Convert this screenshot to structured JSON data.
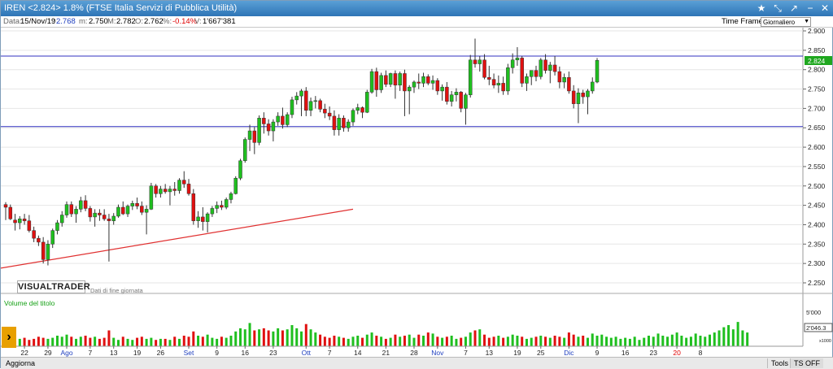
{
  "window": {
    "title": "IREN <2.824> 1.8%  (FTSE Italia Servizi di Pubblica Utilità)",
    "controls": [
      "★",
      "⤡",
      "↗",
      "−",
      "✕"
    ]
  },
  "info": {
    "data_label": "Data:",
    "data_value": "15/Nov/19",
    "colon": ":",
    "close_value": "2.768",
    "min_label": "m:",
    "min_value": "2.750",
    "max_label": "M:",
    "max_value": "2.782",
    "open_label": "O:",
    "open_value": "2.762",
    "pct_label": "%:",
    "pct_value": "-0.14%",
    "vol_label": "V:",
    "vol_value": "1'667'381",
    "timeframe_label": "Time Frame",
    "timeframe_value": "Giornaliero"
  },
  "brand": {
    "logo": "VISUALTRADER",
    "eod_note": "Dati di fine giornata"
  },
  "volume_panel": {
    "label": "Volume del titolo",
    "tick_5000": "5'000",
    "current": "2'046.3",
    "scale": "x1000"
  },
  "bottom": {
    "aggiorna": "Aggiorna",
    "tools": "Tools",
    "ts_off": "TS OFF"
  },
  "colors": {
    "up": "#1fbf1f",
    "down": "#e01010",
    "hline": "#3030c0",
    "trend": "#e03030"
  },
  "chart_data": {
    "type": "candlestick",
    "ylim": [
      2.22,
      2.91
    ],
    "y_ticks": [
      "2.900",
      "2.850",
      "2.800",
      "2.750",
      "2.700",
      "2.650",
      "2.600",
      "2.550",
      "2.500",
      "2.450",
      "2.400",
      "2.350",
      "2.300",
      "2.250"
    ],
    "last_price_label": "2.824",
    "hlines": [
      2.835,
      2.653
    ],
    "trendline": {
      "from": [
        0,
        2.288
      ],
      "to": [
        74,
        2.44
      ]
    },
    "x_labels": [
      {
        "i": 4,
        "t": "22"
      },
      {
        "i": 9,
        "t": "29"
      },
      {
        "i": 13,
        "t": "Ago",
        "month": true
      },
      {
        "i": 18,
        "t": "7"
      },
      {
        "i": 23,
        "t": "13"
      },
      {
        "i": 28,
        "t": "19"
      },
      {
        "i": 33,
        "t": "26"
      },
      {
        "i": 39,
        "t": "Set",
        "month": true
      },
      {
        "i": 45,
        "t": "9"
      },
      {
        "i": 51,
        "t": "16"
      },
      {
        "i": 57,
        "t": "23"
      },
      {
        "i": 64,
        "t": "Ott",
        "month": true
      },
      {
        "i": 69,
        "t": "7"
      },
      {
        "i": 75,
        "t": "14"
      },
      {
        "i": 81,
        "t": "21"
      },
      {
        "i": 87,
        "t": "28"
      },
      {
        "i": 92,
        "t": "Nov",
        "month": true
      },
      {
        "i": 98,
        "t": "7"
      },
      {
        "i": 103,
        "t": "13"
      },
      {
        "i": 109,
        "t": "19"
      },
      {
        "i": 114,
        "t": "25"
      },
      {
        "i": 120,
        "t": "Dic",
        "month": true
      },
      {
        "i": 126,
        "t": "9"
      },
      {
        "i": 132,
        "t": "16"
      },
      {
        "i": 138,
        "t": "23"
      },
      {
        "i": 143,
        "t": "20",
        "red": true
      },
      {
        "i": 148,
        "t": "8"
      }
    ],
    "candles": [
      [
        2.452,
        2.458,
        2.412,
        2.445
      ],
      [
        2.445,
        2.452,
        2.412,
        2.415
      ],
      [
        2.412,
        2.428,
        2.385,
        2.405
      ],
      [
        2.405,
        2.422,
        2.388,
        2.415
      ],
      [
        2.415,
        2.428,
        2.4,
        2.41
      ],
      [
        2.41,
        2.425,
        2.38,
        2.385
      ],
      [
        2.385,
        2.395,
        2.355,
        2.365
      ],
      [
        2.365,
        2.372,
        2.345,
        2.355
      ],
      [
        2.355,
        2.368,
        2.3,
        2.31
      ],
      [
        2.31,
        2.36,
        2.295,
        2.35
      ],
      [
        2.35,
        2.39,
        2.34,
        2.385
      ],
      [
        2.385,
        2.412,
        2.375,
        2.405
      ],
      [
        2.405,
        2.435,
        2.395,
        2.425
      ],
      [
        2.425,
        2.46,
        2.418,
        2.452
      ],
      [
        2.452,
        2.46,
        2.42,
        2.428
      ],
      [
        2.428,
        2.448,
        2.405,
        2.44
      ],
      [
        2.44,
        2.472,
        2.432,
        2.462
      ],
      [
        2.462,
        2.476,
        2.435,
        2.442
      ],
      [
        2.442,
        2.448,
        2.408,
        2.42
      ],
      [
        2.42,
        2.44,
        2.395,
        2.43
      ],
      [
        2.43,
        2.44,
        2.41,
        2.425
      ],
      [
        2.425,
        2.44,
        2.41,
        2.415
      ],
      [
        2.415,
        2.428,
        2.305,
        2.41
      ],
      [
        2.41,
        2.43,
        2.4,
        2.422
      ],
      [
        2.422,
        2.452,
        2.418,
        2.445
      ],
      [
        2.445,
        2.46,
        2.425,
        2.428
      ],
      [
        2.428,
        2.452,
        2.42,
        2.448
      ],
      [
        2.448,
        2.462,
        2.438,
        2.455
      ],
      [
        2.455,
        2.47,
        2.44,
        2.448
      ],
      [
        2.448,
        2.46,
        2.425,
        2.432
      ],
      [
        2.432,
        2.45,
        2.375,
        2.44
      ],
      [
        2.44,
        2.508,
        2.438,
        2.5
      ],
      [
        2.5,
        2.505,
        2.47,
        2.48
      ],
      [
        2.48,
        2.5,
        2.47,
        2.492
      ],
      [
        2.492,
        2.505,
        2.48,
        2.485
      ],
      [
        2.485,
        2.5,
        2.45,
        2.492
      ],
      [
        2.492,
        2.51,
        2.475,
        2.488
      ],
      [
        2.488,
        2.52,
        2.48,
        2.515
      ],
      [
        2.515,
        2.538,
        2.495,
        2.505
      ],
      [
        2.505,
        2.518,
        2.475,
        2.48
      ],
      [
        2.48,
        2.492,
        2.4,
        2.41
      ],
      [
        2.41,
        2.435,
        2.392,
        2.42
      ],
      [
        2.42,
        2.445,
        2.385,
        2.408
      ],
      [
        2.408,
        2.432,
        2.38,
        2.428
      ],
      [
        2.428,
        2.448,
        2.42,
        2.442
      ],
      [
        2.442,
        2.46,
        2.43,
        2.45
      ],
      [
        2.45,
        2.462,
        2.438,
        2.445
      ],
      [
        2.445,
        2.47,
        2.44,
        2.465
      ],
      [
        2.465,
        2.485,
        2.455,
        2.48
      ],
      [
        2.48,
        2.525,
        2.478,
        2.52
      ],
      [
        2.52,
        2.57,
        2.515,
        2.565
      ],
      [
        2.565,
        2.625,
        2.56,
        2.62
      ],
      [
        2.62,
        2.658,
        2.59,
        2.642
      ],
      [
        2.642,
        2.652,
        2.582,
        2.612
      ],
      [
        2.612,
        2.682,
        2.605,
        2.675
      ],
      [
        2.675,
        2.69,
        2.635,
        2.66
      ],
      [
        2.66,
        2.672,
        2.63,
        2.642
      ],
      [
        2.642,
        2.672,
        2.615,
        2.665
      ],
      [
        2.665,
        2.69,
        2.655,
        2.68
      ],
      [
        2.68,
        2.702,
        2.648,
        2.658
      ],
      [
        2.658,
        2.69,
        2.652,
        2.684
      ],
      [
        2.684,
        2.73,
        2.675,
        2.722
      ],
      [
        2.722,
        2.742,
        2.71,
        2.732
      ],
      [
        2.732,
        2.75,
        2.68,
        2.745
      ],
      [
        2.745,
        2.755,
        2.68,
        2.695
      ],
      [
        2.695,
        2.728,
        2.68,
        2.718
      ],
      [
        2.718,
        2.732,
        2.7,
        2.72
      ],
      [
        2.72,
        2.725,
        2.69,
        2.698
      ],
      [
        2.698,
        2.712,
        2.675,
        2.688
      ],
      [
        2.688,
        2.705,
        2.67,
        2.68
      ],
      [
        2.68,
        2.695,
        2.63,
        2.645
      ],
      [
        2.645,
        2.685,
        2.63,
        2.675
      ],
      [
        2.675,
        2.682,
        2.64,
        2.65
      ],
      [
        2.65,
        2.672,
        2.64,
        2.665
      ],
      [
        2.665,
        2.7,
        2.655,
        2.695
      ],
      [
        2.695,
        2.712,
        2.685,
        2.702
      ],
      [
        2.702,
        2.705,
        2.675,
        2.69
      ],
      [
        2.69,
        2.748,
        2.688,
        2.742
      ],
      [
        2.742,
        2.802,
        2.738,
        2.795
      ],
      [
        2.795,
        2.805,
        2.73,
        2.748
      ],
      [
        2.748,
        2.792,
        2.74,
        2.785
      ],
      [
        2.785,
        2.798,
        2.755,
        2.762
      ],
      [
        2.762,
        2.792,
        2.755,
        2.79
      ],
      [
        2.79,
        2.798,
        2.725,
        2.76
      ],
      [
        2.76,
        2.795,
        2.745,
        2.79
      ],
      [
        2.79,
        2.8,
        2.68,
        2.745
      ],
      [
        2.745,
        2.76,
        2.685,
        2.755
      ],
      [
        2.755,
        2.772,
        2.74,
        2.768
      ],
      [
        2.768,
        2.79,
        2.75,
        2.765
      ],
      [
        2.765,
        2.792,
        2.755,
        2.782
      ],
      [
        2.782,
        2.788,
        2.76,
        2.765
      ],
      [
        2.765,
        2.785,
        2.748,
        2.772
      ],
      [
        2.772,
        2.778,
        2.735,
        2.745
      ],
      [
        2.745,
        2.762,
        2.72,
        2.755
      ],
      [
        2.755,
        2.768,
        2.71,
        2.718
      ],
      [
        2.718,
        2.745,
        2.705,
        2.735
      ],
      [
        2.735,
        2.752,
        2.718,
        2.742
      ],
      [
        2.742,
        2.745,
        2.69,
        2.7
      ],
      [
        2.7,
        2.74,
        2.658,
        2.735
      ],
      [
        2.735,
        2.838,
        2.728,
        2.825
      ],
      [
        2.825,
        2.88,
        2.805,
        2.815
      ],
      [
        2.815,
        2.835,
        2.795,
        2.825
      ],
      [
        2.825,
        2.84,
        2.775,
        2.78
      ],
      [
        2.78,
        2.81,
        2.76,
        2.775
      ],
      [
        2.775,
        2.79,
        2.752,
        2.76
      ],
      [
        2.76,
        2.785,
        2.74,
        2.765
      ],
      [
        2.765,
        2.782,
        2.735,
        2.745
      ],
      [
        2.745,
        2.815,
        2.735,
        2.805
      ],
      [
        2.805,
        2.842,
        2.79,
        2.825
      ],
      [
        2.825,
        2.858,
        2.81,
        2.83
      ],
      [
        2.83,
        2.835,
        2.755,
        2.765
      ],
      [
        2.765,
        2.79,
        2.745,
        2.782
      ],
      [
        2.782,
        2.795,
        2.76,
        2.798
      ],
      [
        2.798,
        2.81,
        2.77,
        2.782
      ],
      [
        2.782,
        2.83,
        2.775,
        2.825
      ],
      [
        2.825,
        2.84,
        2.79,
        2.798
      ],
      [
        2.798,
        2.82,
        2.765,
        2.812
      ],
      [
        2.812,
        2.835,
        2.785,
        2.795
      ],
      [
        2.795,
        2.808,
        2.752,
        2.768
      ],
      [
        2.768,
        2.79,
        2.752,
        2.78
      ],
      [
        2.78,
        2.795,
        2.738,
        2.745
      ],
      [
        2.745,
        2.76,
        2.7,
        2.712
      ],
      [
        2.712,
        2.752,
        2.662,
        2.74
      ],
      [
        2.74,
        2.748,
        2.712,
        2.73
      ],
      [
        2.73,
        2.75,
        2.685,
        2.745
      ],
      [
        2.745,
        2.78,
        2.738,
        2.768
      ],
      [
        2.768,
        2.83,
        2.765,
        2.824
      ]
    ],
    "volumes": [
      0.9,
      0.6,
      0.5,
      0.7,
      0.8,
      0.6,
      0.7,
      0.9,
      0.8,
      0.7,
      0.8,
      1.0,
      0.9,
      1.1,
      0.9,
      0.7,
      0.9,
      1.0,
      0.8,
      0.9,
      0.7,
      0.8,
      1.5,
      0.8,
      0.6,
      0.9,
      0.7,
      0.6,
      0.8,
      0.9,
      0.7,
      0.8,
      0.6,
      0.7,
      0.7,
      0.6,
      0.9,
      0.7,
      1.0,
      0.9,
      1.4,
      1.0,
      0.9,
      1.1,
      0.8,
      0.7,
      0.9,
      0.8,
      1.0,
      1.4,
      1.7,
      1.6,
      2.2,
      1.5,
      1.6,
      1.7,
      1.5,
      1.4,
      1.7,
      1.5,
      1.6,
      2.0,
      1.7,
      1.4,
      2.1,
      1.6,
      1.3,
      1.1,
      0.9,
      0.8,
      1.0,
      0.9,
      0.8,
      0.7,
      0.9,
      1.0,
      0.8,
      1.1,
      1.3,
      1.0,
      0.9,
      0.7,
      0.8,
      1.1,
      0.9,
      1.0,
      1.1,
      0.8,
      1.1,
      1.0,
      1.3,
      1.2,
      0.9,
      0.8,
      0.9,
      1.0,
      0.7,
      0.8,
      0.9,
      1.3,
      1.5,
      1.6,
      1.1,
      0.8,
      0.9,
      1.0,
      0.8,
      0.9,
      1.1,
      1.0,
      0.9,
      0.7,
      0.8,
      0.9,
      1.0,
      0.9,
      0.8,
      1.0,
      0.9,
      0.8,
      1.3,
      1.1,
      0.9,
      1.0,
      0.8,
      1.2,
      1.0,
      1.1,
      0.9,
      0.8,
      0.9,
      0.7,
      0.8,
      0.7,
      0.9,
      0.6,
      0.8,
      1.0,
      0.9,
      1.2,
      1.0,
      0.9,
      1.1,
      1.3,
      1.0,
      0.8,
      0.9,
      1.2,
      1.0,
      0.9,
      1.1,
      1.3,
      1.5,
      1.8,
      2.0,
      1.6,
      2.3,
      1.5,
      1.3
    ]
  }
}
